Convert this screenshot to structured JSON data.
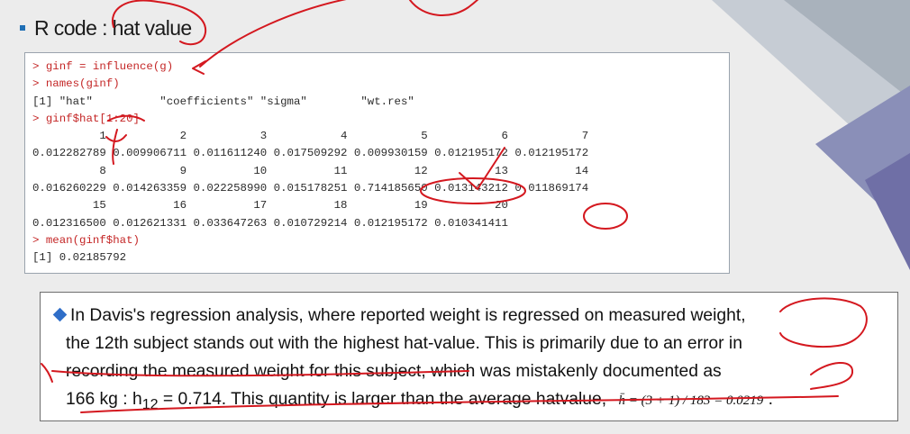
{
  "slide": {
    "title": "R code : hat value",
    "code_lines": [
      {
        "text": "> ginf = influence(g)",
        "type": "cmd"
      },
      {
        "text": "> names(ginf)",
        "type": "cmd"
      },
      {
        "text": "[1] \"hat\"          \"coefficients\" \"sigma\"        \"wt.res\"",
        "type": "out"
      },
      {
        "text": "> ginf$hat[1:20]",
        "type": "cmd"
      },
      {
        "text": "          1           2           3           4           5           6           7",
        "type": "out"
      },
      {
        "text": "0.012282789 0.009906711 0.011611240 0.017509292 0.009930159 0.012195172 0.012195172",
        "type": "out"
      },
      {
        "text": "          8           9          10          11          12          13          14",
        "type": "out"
      },
      {
        "text": "0.016260229 0.014263359 0.022258990 0.015178251 0.714185650 0.013143212 0.011869174",
        "type": "out"
      },
      {
        "text": "         15          16          17          18          19          20",
        "type": "out"
      },
      {
        "text": "0.012316500 0.012621331 0.033647263 0.010729214 0.012195172 0.010341411",
        "type": "out"
      },
      {
        "text": "> mean(ginf$hat)",
        "type": "cmd"
      },
      {
        "text": "[1] 0.02185792",
        "type": "out"
      }
    ],
    "note": {
      "line1": "In Davis's regression analysis, where reported weight is regressed on measured weight,",
      "line2": "the 12th subject stands out with the highest hat-value. This is primarily due to an error in",
      "line3": "recording the measured weight for this subject, which was mistakenly documented as",
      "line4_a": "166 kg : h",
      "line4_sub": "12",
      "line4_b": " = 0.714. This quantity is  larger than the average hatvalue,",
      "formula": "h̄ = (3 + 1) / 183 = 0.0219",
      "period": "."
    },
    "colors": {
      "accent_blue": "#2f6ec8",
      "annotation_red": "#d4181f",
      "code_red": "#c42626"
    }
  }
}
